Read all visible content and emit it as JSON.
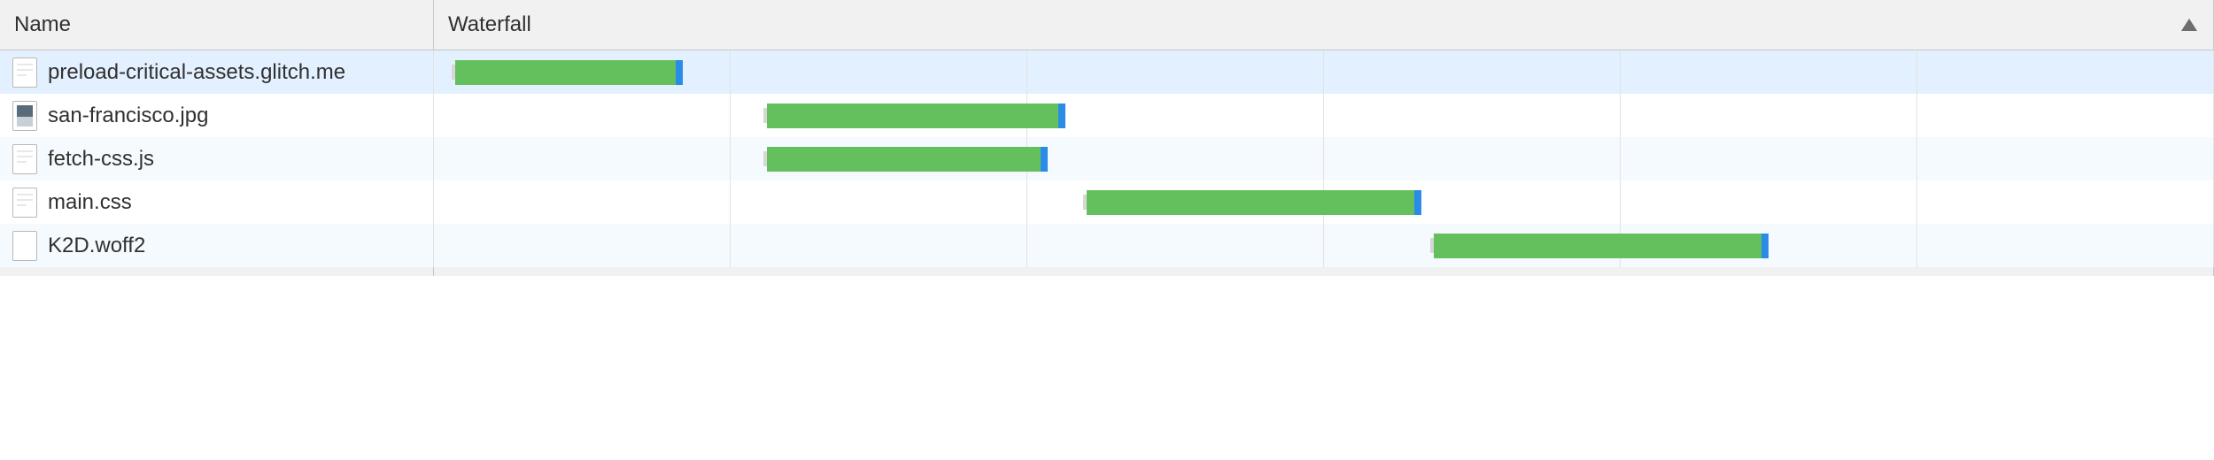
{
  "columns": {
    "name": "Name",
    "waterfall": "Waterfall",
    "sort_column": "waterfall",
    "sort_direction": "asc"
  },
  "waterfall_axis": {
    "ticks": 6,
    "domain_start_pct": 0,
    "domain_end_pct": 100
  },
  "chart_data": {
    "type": "bar",
    "title": "Network request waterfall",
    "xlabel": "",
    "ylabel": "",
    "domain_unit": "percent_of_visible_timeline",
    "series": [
      {
        "name": "preload-critical-assets.glitch.me",
        "start": 1.0,
        "end": 14.0
      },
      {
        "name": "san-francisco.jpg",
        "start": 18.5,
        "end": 35.5
      },
      {
        "name": "fetch-css.js",
        "start": 18.5,
        "end": 34.5
      },
      {
        "name": "main.css",
        "start": 36.5,
        "end": 55.5
      },
      {
        "name": "K2D.woff2",
        "start": 56.0,
        "end": 75.0
      }
    ]
  },
  "rows": [
    {
      "name": "preload-critical-assets.glitch.me",
      "icon": "document",
      "selected": true,
      "bar": {
        "start": 1.0,
        "end": 14.0
      }
    },
    {
      "name": "san-francisco.jpg",
      "icon": "image",
      "selected": false,
      "bar": {
        "start": 18.5,
        "end": 35.5
      }
    },
    {
      "name": "fetch-css.js",
      "icon": "document",
      "selected": false,
      "bar": {
        "start": 18.5,
        "end": 34.5
      }
    },
    {
      "name": "main.css",
      "icon": "document",
      "selected": false,
      "bar": {
        "start": 36.5,
        "end": 55.5
      }
    },
    {
      "name": "K2D.woff2",
      "icon": "blank",
      "selected": false,
      "bar": {
        "start": 56.0,
        "end": 75.0
      }
    }
  ]
}
